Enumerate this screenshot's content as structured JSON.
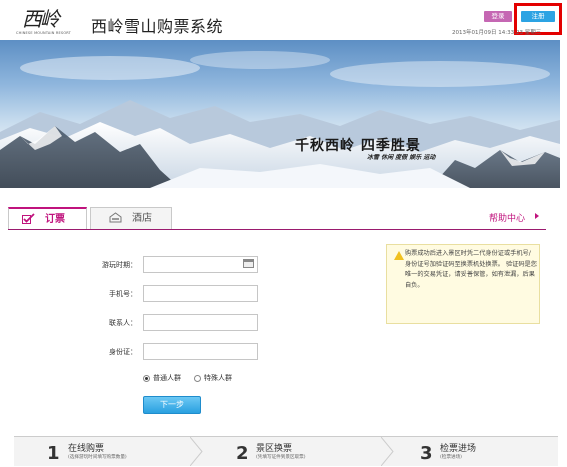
{
  "header": {
    "logo_script": "西岭",
    "logo_sub": "CHINESE MOUNTAIN RESORT",
    "title": "西岭雪山购票系统",
    "login_label": "登录",
    "register_label": "注册",
    "datetime": "2013年01月09日  14:33:23 星期三"
  },
  "banner": {
    "slogan": "千秋西岭  四季胜景",
    "tags": "冰雪  休闲  度假  娱乐  运动"
  },
  "tabs": [
    {
      "label": "订票",
      "icon": "checkmark-icon"
    },
    {
      "label": "酒店",
      "icon": "hotel-icon"
    }
  ],
  "help": {
    "label": "帮助中心"
  },
  "form": {
    "date_label": "游玩时期：",
    "date_value": "",
    "phone_label": "手机号：",
    "phone_value": "",
    "contact_label": "联系人：",
    "contact_value": "",
    "id_label": "身份证：",
    "id_value": "",
    "radio_options": [
      "普通人群",
      "特殊人群"
    ],
    "radio_selected": "普通人群",
    "next_label": "下一步"
  },
  "notice": {
    "text": "购票成功后进入景区时凭二代身份证或手机号/身份证号加验证码至换票机处换票。 验证码是您唯一的交易凭证，请妥善保管，如有泄漏，后果自负。"
  },
  "steps": [
    {
      "num": "1",
      "title": "在线购票",
      "sub": "(选择游玩时间填写购票数量)"
    },
    {
      "num": "2",
      "title": "景区换票",
      "sub": "(凭填写证件到景区取票)"
    },
    {
      "num": "3",
      "title": "检票进场",
      "sub": "(检票进场)"
    }
  ],
  "colors": {
    "accent": "#c0137d",
    "login_button": "#c567b3",
    "register_button": "#2ca3e3",
    "highlight": "#e30000"
  }
}
